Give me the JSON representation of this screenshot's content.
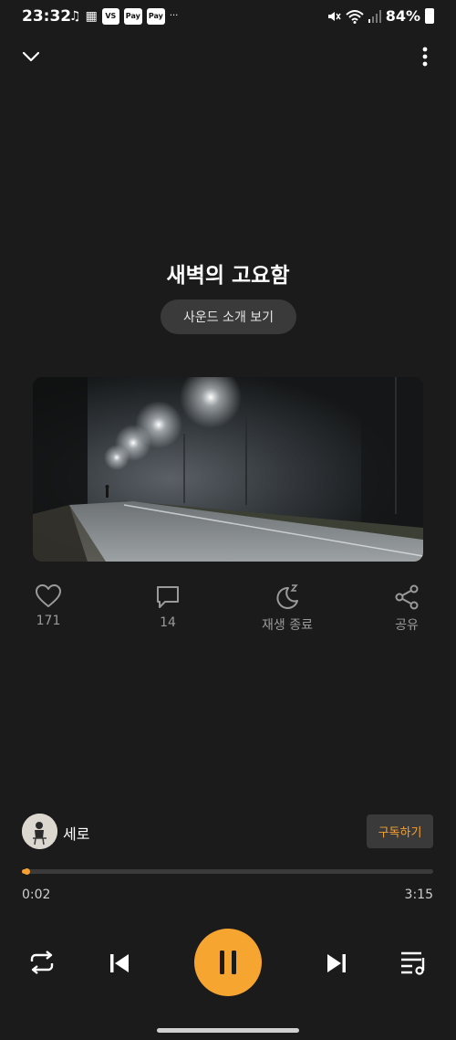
{
  "status_bar": {
    "time": "23:32",
    "left_icons": [
      "music-note-icon",
      "calendar-icon",
      "vs-icon",
      "pay-icon",
      "pay-icon",
      "more-dots-icon"
    ],
    "vs_label": "VS",
    "pay_label": "Pay",
    "ellipsis": "···",
    "battery": "84%"
  },
  "track": {
    "title": "새벽의 고요함",
    "intro_button": "사운드 소개 보기"
  },
  "actions": {
    "like_count": "171",
    "comment_count": "14",
    "sleep_label": "재생 종료",
    "share_label": "공유"
  },
  "artist": {
    "name": "세로",
    "subscribe_label": "구독하기"
  },
  "player": {
    "current_time": "0:02",
    "total_time": "3:15",
    "progress_fraction": 0.0103,
    "accent_color": "#f7a531"
  }
}
